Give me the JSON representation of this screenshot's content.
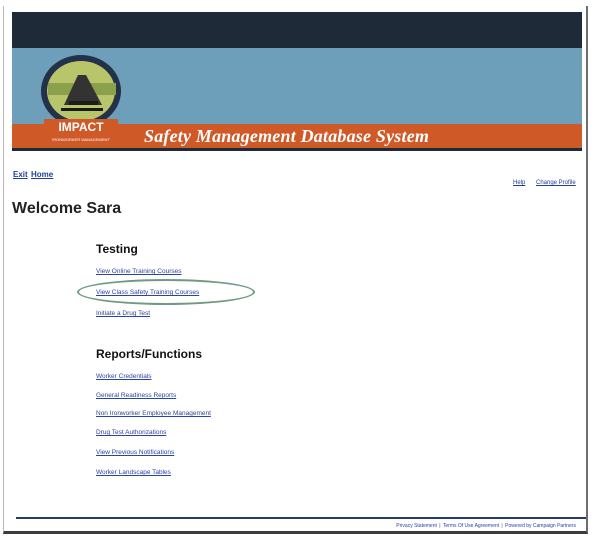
{
  "banner": {
    "title": "Safety Management Database System",
    "logo_text": "IMPACT",
    "logo_subtext": "IRONWORKER MANAGEMENT"
  },
  "nav": {
    "left_links": [
      "Exit",
      "Home"
    ],
    "right_links": [
      "Help",
      "Change Profile"
    ]
  },
  "welcome_text": "Welcome Sara",
  "testing": {
    "title": "Testing",
    "links": [
      "View Online Training Courses",
      "View Class Safety Training Courses",
      "Initiate a Drug Test"
    ]
  },
  "reports": {
    "title": "Reports/Functions",
    "links": [
      "Worker Credentials",
      "General Readiness Reports",
      "Non Ironworker Employee Management",
      "Drug Test Authorizations",
      "View Previous Notifications",
      "Worker Landscape Tables"
    ]
  },
  "footer": {
    "links": [
      "Privacy Statement",
      "Terms Of Use Agreement",
      "Powered by Campaign Partners"
    ]
  },
  "colors": {
    "topbar": "#1f2a38",
    "sky": "#6d9fbb",
    "banner_orange": "#cf5a28",
    "link_blue": "#2b43a5",
    "highlight_ring": "#6f9b82"
  }
}
